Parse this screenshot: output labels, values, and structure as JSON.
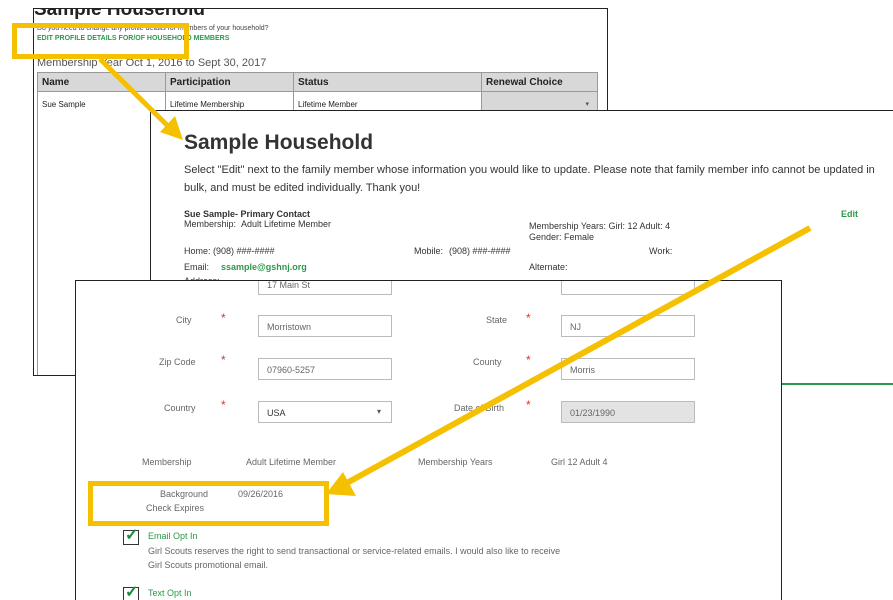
{
  "household_overview": {
    "title": "Sample Household",
    "question": "Do you need to change any profile details for members of your household?",
    "edit_link": "EDIT PROFILE DETAILS FOR/OF HOUSEHOLD MEMBERS",
    "membership_year": "Membership Year Oct 1, 2016 to Sept 30, 2017",
    "columns": [
      "Name",
      "Participation",
      "Status",
      "Renewal Choice"
    ],
    "row": {
      "name": "Sue Sample",
      "participation": "Lifetime Membership",
      "status": "Lifetime Member",
      "renewal_choice": ""
    }
  },
  "household_detail": {
    "title": "Sample Household",
    "instructions": "Select \"Edit\" next to the family member whose information you would like to update. Please note that family member info cannot be updated in bulk, and must be edited individually. Thank you!",
    "member_name": "Sue Sample- Primary Contact",
    "edit_label": "Edit",
    "membership_label": "Membership:",
    "membership_value": "Adult Lifetime Member",
    "membership_years": "Membership Years: Girl: 12 Adult: 4",
    "gender": "Gender: Female",
    "home_label": "Home:",
    "home_value": "(908) ###-####",
    "mobile_label": "Mobile:",
    "mobile_value": "(908) ###-####",
    "work_label": "Work:",
    "email_label": "Email:",
    "email_value": "ssample@gshnj.org",
    "alternate_label": "Alternate:",
    "address_label": "Address:",
    "address_value": "17 Main St"
  },
  "profile_form": {
    "city_label": "City",
    "city_value": "Morristown",
    "state_label": "State",
    "state_value": "NJ",
    "zip_label": "Zip Code",
    "zip_value": "07960-5257",
    "county_label": "County",
    "county_value": "Morris",
    "country_label": "Country",
    "country_value": "USA",
    "dob_label": "Date of Birth",
    "dob_value": "01/23/1990",
    "membership_label": "Membership",
    "membership_value": "Adult Lifetime Member",
    "membership_years_label": "Membership Years",
    "membership_years_value": "Girl 12 Adult 4",
    "background_label_1": "Background",
    "background_label_2": "Check Expires",
    "background_value": "09/26/2016",
    "email_opt_label": "Email Opt In",
    "email_opt_text_1": "Girl Scouts reserves the right to send transactional or service-related emails. I would also like to receive",
    "email_opt_text_2": "Girl Scouts promotional email.",
    "text_opt_label": "Text Opt In",
    "required_mark": "*"
  },
  "colors": {
    "highlight": "#f5c000",
    "accent_green": "#2a9a4a",
    "required_red": "#dd3333"
  }
}
